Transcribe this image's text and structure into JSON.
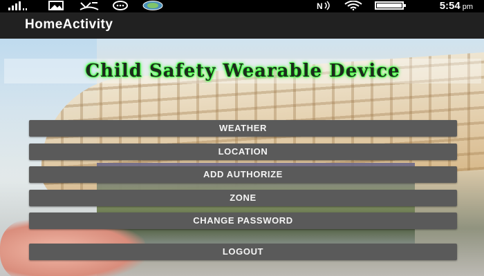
{
  "status_bar": {
    "time": "5:54",
    "ampm": "pm",
    "icons": [
      "signal-bars-icon",
      "image-icon",
      "missed-call-icon",
      "chat-icon",
      "app-icon",
      "nfc-icon",
      "wifi-icon",
      "battery-icon"
    ]
  },
  "toolbar": {
    "title": "HomeActivity"
  },
  "banner": {
    "text": "Child Safety Wearable Device"
  },
  "menu": [
    {
      "label": "WEATHER"
    },
    {
      "label": "LOCATION"
    },
    {
      "label": "ADD AUTHORIZE"
    },
    {
      "label": "ZONE"
    },
    {
      "label": "CHANGE PASSWORD"
    },
    {
      "label": "LOGOUT"
    }
  ]
}
